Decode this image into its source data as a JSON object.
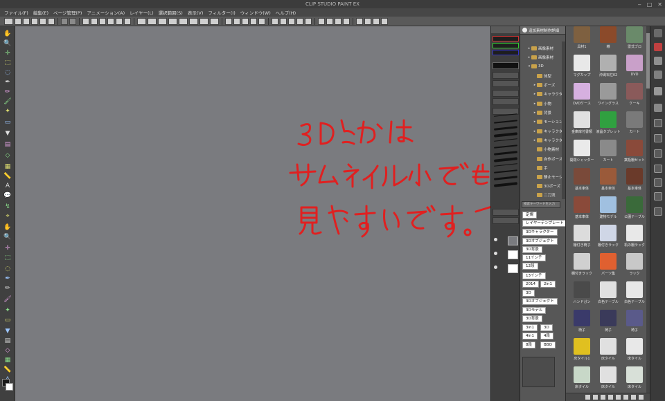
{
  "app": {
    "title": "CLIP STUDIO PAINT EX"
  },
  "window_controls": {
    "minimize": "‒",
    "maximize": "□",
    "close": "✕"
  },
  "menu": [
    {
      "label": "ファイル(F)"
    },
    {
      "label": "編集(E)"
    },
    {
      "label": "ページ管理(P)"
    },
    {
      "label": "アニメーション(A)"
    },
    {
      "label": "レイヤー(L)"
    },
    {
      "label": "選択範囲(S)"
    },
    {
      "label": "表示(V)"
    },
    {
      "label": "フィルター(I)"
    },
    {
      "label": "ウィンドウ(W)"
    },
    {
      "label": "ヘルプ(H)"
    }
  ],
  "tools": [
    {
      "icon": "hand-icon",
      "glyph": "✋"
    },
    {
      "icon": "zoom-icon",
      "glyph": "🔍"
    },
    {
      "icon": "move-icon",
      "glyph": "✛"
    },
    {
      "icon": "select-icon",
      "glyph": "⬚"
    },
    {
      "icon": "lasso-icon",
      "glyph": "◌"
    },
    {
      "icon": "pen-icon",
      "glyph": "✒"
    },
    {
      "icon": "pencil-icon",
      "glyph": "✏"
    },
    {
      "icon": "brush-icon",
      "glyph": "🖌"
    },
    {
      "icon": "airbrush-icon",
      "glyph": "✦"
    },
    {
      "icon": "eraser-icon",
      "glyph": "▭"
    },
    {
      "icon": "fill-icon",
      "glyph": "▼"
    },
    {
      "icon": "gradient-icon",
      "glyph": "▤"
    },
    {
      "icon": "shape-icon",
      "glyph": "◇"
    },
    {
      "icon": "frame-icon",
      "glyph": "▦"
    },
    {
      "icon": "ruler-icon",
      "glyph": "📏"
    },
    {
      "icon": "text-icon",
      "glyph": "A"
    },
    {
      "icon": "balloon-icon",
      "glyph": "💬"
    },
    {
      "icon": "correction-icon",
      "glyph": "↯"
    },
    {
      "icon": "eyedropper-icon",
      "glyph": "⌖"
    }
  ],
  "tool_colors": {
    "main": "#1a1a1a",
    "sub": "#ffffff"
  },
  "material_panel": {
    "header": "追加素材制作詳細",
    "tree": [
      {
        "label": "画像素材",
        "indent": 1,
        "expand": "▸"
      },
      {
        "label": "画像素材",
        "indent": 1,
        "expand": "▸"
      },
      {
        "label": "3D",
        "indent": 1,
        "expand": "▾"
      },
      {
        "label": "体型",
        "indent": 2,
        "expand": ""
      },
      {
        "label": "ポーズ",
        "indent": 2,
        "expand": "▸"
      },
      {
        "label": "キャラクター",
        "indent": 2,
        "expand": "▸"
      },
      {
        "label": "小物",
        "indent": 2,
        "expand": "▸"
      },
      {
        "label": "背景",
        "indent": 2,
        "expand": "▸"
      },
      {
        "label": "モーション",
        "indent": 2,
        "expand": "▸"
      },
      {
        "label": "キャラクター",
        "indent": 2,
        "expand": "▸"
      },
      {
        "label": "キャラクター",
        "indent": 2,
        "expand": "▸"
      },
      {
        "label": "小物素材",
        "indent": 2,
        "expand": ""
      },
      {
        "label": "自作ポーズ",
        "indent": 2,
        "expand": ""
      },
      {
        "label": "手",
        "indent": 2,
        "expand": ""
      },
      {
        "label": "静止モーション",
        "indent": 2,
        "expand": ""
      },
      {
        "label": "3Dポーズ",
        "indent": 2,
        "expand": ""
      },
      {
        "label": "二刀流",
        "indent": 2,
        "expand": ""
      }
    ],
    "search_placeholder": "検索キーワードを入力",
    "tags": [
      [
        "定規"
      ],
      [
        "レイヤーテンプレート"
      ],
      [
        "3Dキャラクター"
      ],
      [
        "3Dオブジェクト"
      ],
      [
        "3D背景"
      ],
      [
        "11インチ"
      ],
      [
        "12段"
      ],
      [
        "13インチ"
      ],
      [
        "2014",
        "2in1"
      ],
      [
        "3D"
      ],
      [
        "3Dオブジェクト"
      ],
      [
        "3Dモデル"
      ],
      [
        "3D背景"
      ],
      [
        "3in1",
        "3D"
      ],
      [
        "4in1",
        "4段"
      ],
      [
        "8段",
        "BBQ"
      ]
    ]
  },
  "material_grid": {
    "items": [
      {
        "label": "具材1",
        "thumb": "#7e6040"
      },
      {
        "label": "樽",
        "thumb": "#8b4a2a"
      },
      {
        "label": "雷式ブロ",
        "thumb": "#6a8a6a"
      },
      {
        "label": "マグカップ",
        "thumb": "#e8e8e8"
      },
      {
        "label": "沖縄石柱02",
        "thumb": "#b0b0b0"
      },
      {
        "label": "DVD",
        "thumb": "#c9a0c9"
      },
      {
        "label": "DVDケース",
        "thumb": "#d6b0e0"
      },
      {
        "label": "ワイングラス",
        "thumb": "#9a9a9a"
      },
      {
        "label": "ケーキ",
        "thumb": "#8a5a5a"
      },
      {
        "label": "金庫扉付書類",
        "thumb": "#e0e0e0"
      },
      {
        "label": "液晶タブレット",
        "thumb": "#30a040"
      },
      {
        "label": "カート",
        "thumb": "#7a7a7a"
      },
      {
        "label": "開閉シャッター",
        "thumb": "#eaeaea"
      },
      {
        "label": "カート",
        "thumb": "#8a8a8a"
      },
      {
        "label": "薬瓶棚セット",
        "thumb": "#8a4a3a"
      },
      {
        "label": "基本車体",
        "thumb": "#7a4a3a"
      },
      {
        "label": "基本車体",
        "thumb": "#9a5a3a"
      },
      {
        "label": "基本車体",
        "thumb": "#6a3a2a"
      },
      {
        "label": "基本車体",
        "thumb": "#8a4a3a"
      },
      {
        "label": "建物モデル",
        "thumb": "#a0c0e0"
      },
      {
        "label": "公園テーブル",
        "thumb": "#3a6a3a"
      },
      {
        "label": "棚付き椅子",
        "thumb": "#dcdcdc"
      },
      {
        "label": "棚付きラック",
        "thumb": "#cfd6e6"
      },
      {
        "label": "机の棚ラック",
        "thumb": "#e8e8e8"
      },
      {
        "label": "棚付きラック",
        "thumb": "#d0d0d0"
      },
      {
        "label": "パーツ集",
        "thumb": "#e06030"
      },
      {
        "label": "ラック",
        "thumb": "#c8c8c8"
      },
      {
        "label": "ハンドガン",
        "thumb": "#4a4a4a"
      },
      {
        "label": "白色テーブル",
        "thumb": "#e0e0e0"
      },
      {
        "label": "白色テーブル",
        "thumb": "#e8e8e8"
      },
      {
        "label": "椅子",
        "thumb": "#3a3a6a"
      },
      {
        "label": "椅子",
        "thumb": "#3a3a5a"
      },
      {
        "label": "椅子",
        "thumb": "#5a5a8a"
      },
      {
        "label": "床タイル1",
        "thumb": "#e0c020"
      },
      {
        "label": "床タイル",
        "thumb": "#e0e0e0"
      },
      {
        "label": "床タイル",
        "thumb": "#e8e8e8"
      },
      {
        "label": "床タイル",
        "thumb": "#c8d8c8"
      },
      {
        "label": "床タイル",
        "thumb": "#e0e0e0"
      },
      {
        "label": "床タイル",
        "thumb": "#d8e0d8"
      }
    ]
  },
  "annotation": {
    "lines": [
      "3Dとかは",
      "サムネイル小でも",
      "見やすいです。"
    ],
    "ink": "#e02020"
  }
}
